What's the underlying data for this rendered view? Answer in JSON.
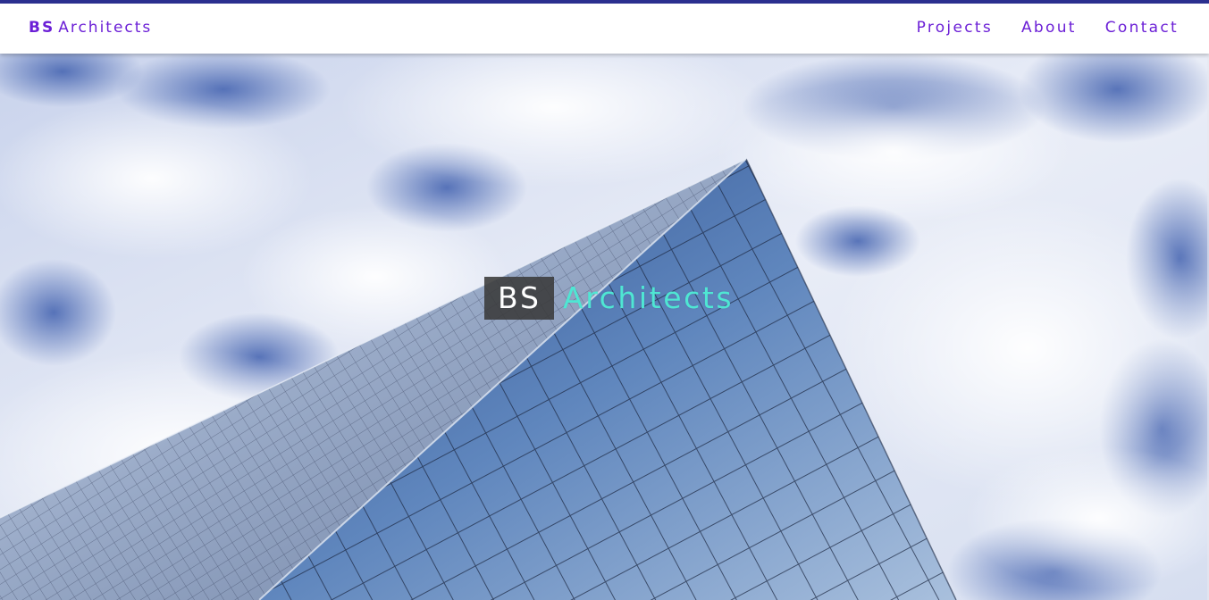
{
  "navbar": {
    "brand_strong": "BS",
    "brand_rest": "Architects",
    "links": [
      {
        "label": "Projects"
      },
      {
        "label": "About"
      },
      {
        "label": "Contact"
      }
    ]
  },
  "hero": {
    "title_box": "BS",
    "title_rest": "Architects",
    "image_subject": "glass-skyscraper-against-cloudy-sky"
  },
  "colors": {
    "accent_strip": "#2b2f8f",
    "nav_text": "#6b1fd6",
    "hero_title_accent": "#4fe6d3",
    "hero_box_bg": "#3a3a3a"
  }
}
